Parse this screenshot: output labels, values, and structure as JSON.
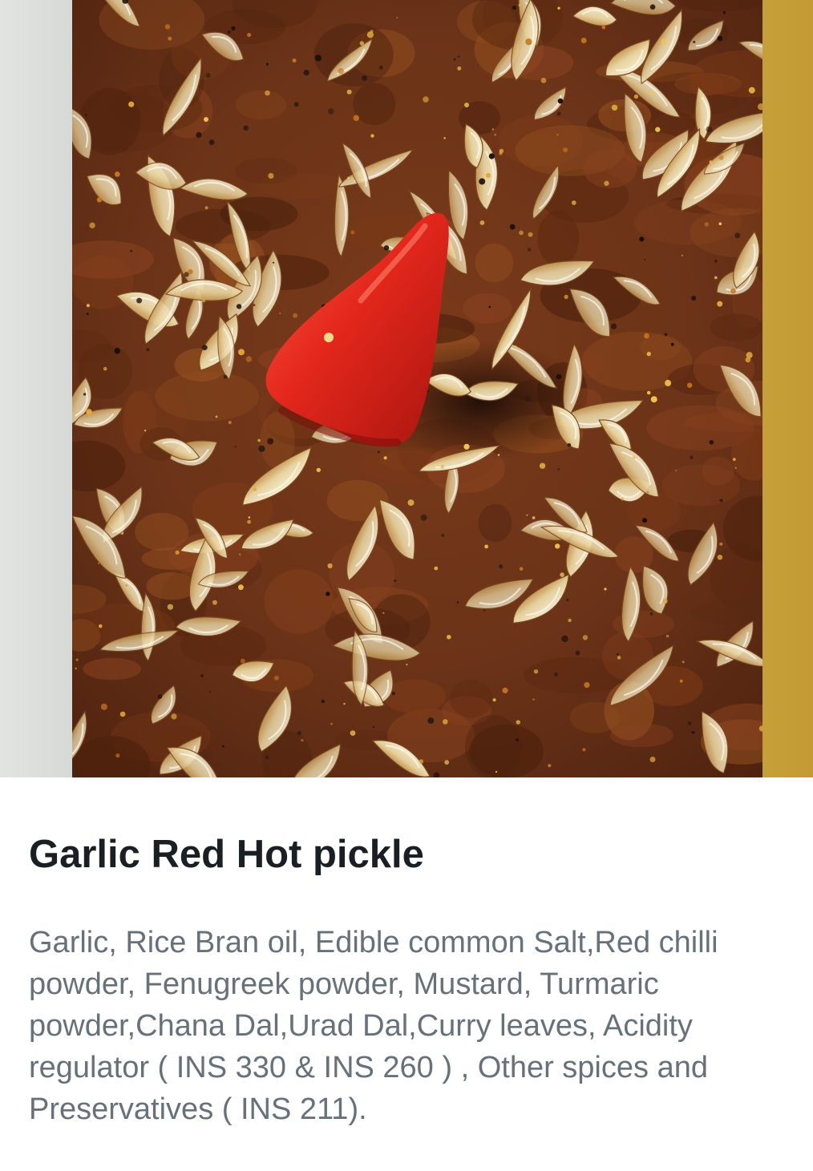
{
  "product": {
    "image_icon": "product-photo",
    "title": "Garlic Red Hot pickle",
    "ingredients": "Garlic, Rice Bran oil, Edible common Salt,Red chilli powder, Fenugreek powder, Mustard, Turmaric powder,Chana Dal,Urad Dal,Curry leaves, Acidity regulator ( INS 330 & INS 260 ) , Other spices and Preservatives ( INS 211)."
  },
  "colors": {
    "title_text": "#1a1f24",
    "body_text": "#66717a",
    "pickle_base": "#6b3318",
    "chilli_red": "#e0261c",
    "garlic": "#ead9a8",
    "right_band": "#c49a33",
    "left_band": "#dcdfdc"
  }
}
